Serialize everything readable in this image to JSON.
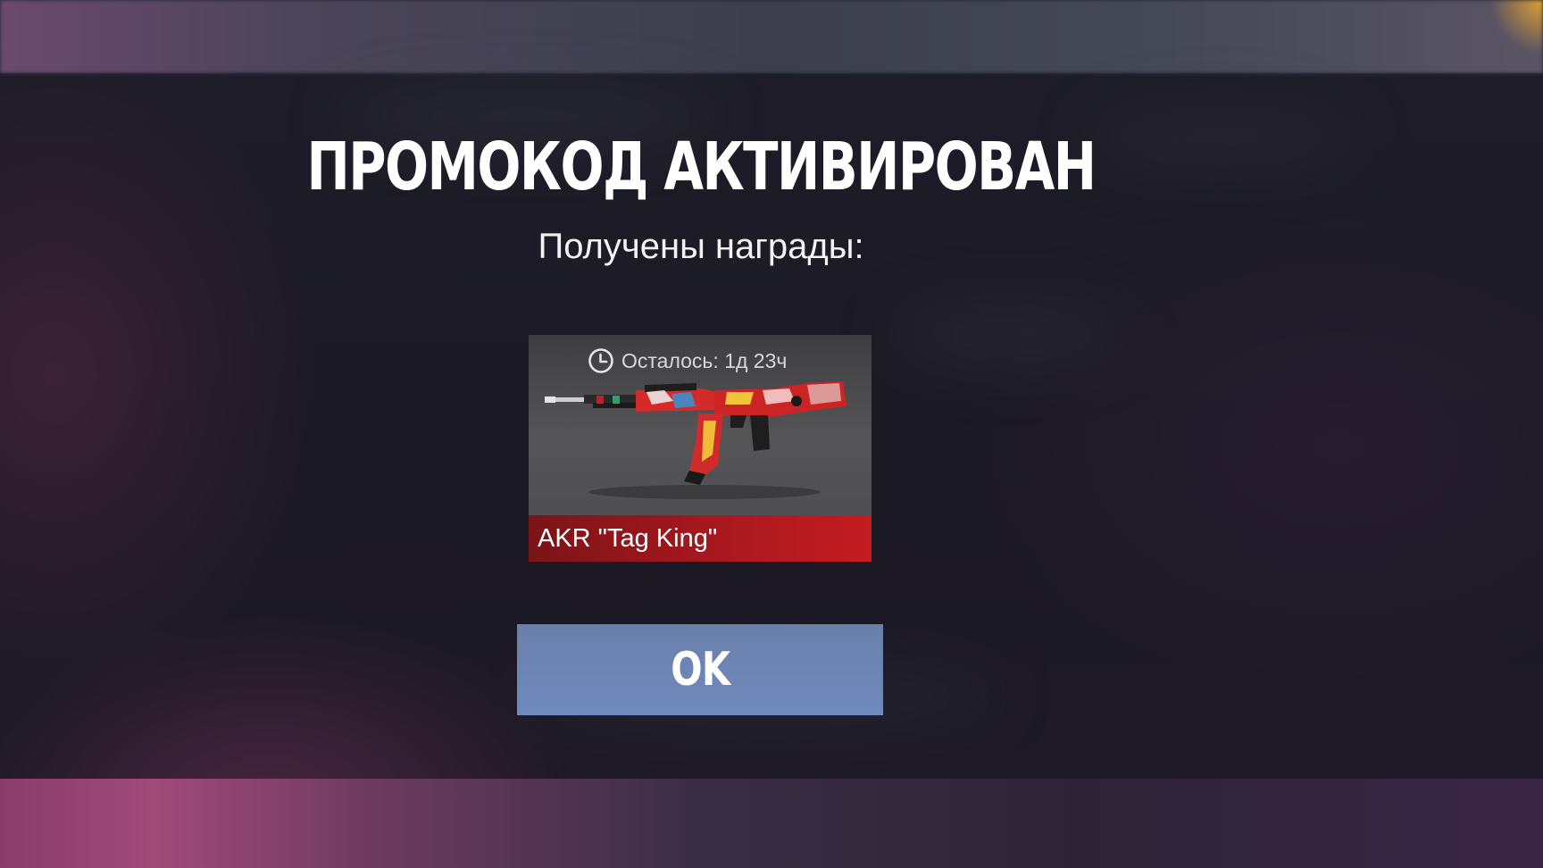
{
  "dialog": {
    "title": "ПРОМОКОД АКТИВИРОВАН",
    "subtitle": "Получены награды:"
  },
  "reward": {
    "timer_icon": "clock-icon",
    "timer_text": "Осталось: 1д 23ч",
    "item_name": "AKR \"Tag King\"",
    "item_icon": "rifle-skin-image",
    "rarity_color": "#b0181e"
  },
  "actions": {
    "ok_label": "OK",
    "ok_color": "#6f86b8"
  },
  "colors": {
    "background": "#1f1d28",
    "accent_pink": "#a04a78"
  }
}
